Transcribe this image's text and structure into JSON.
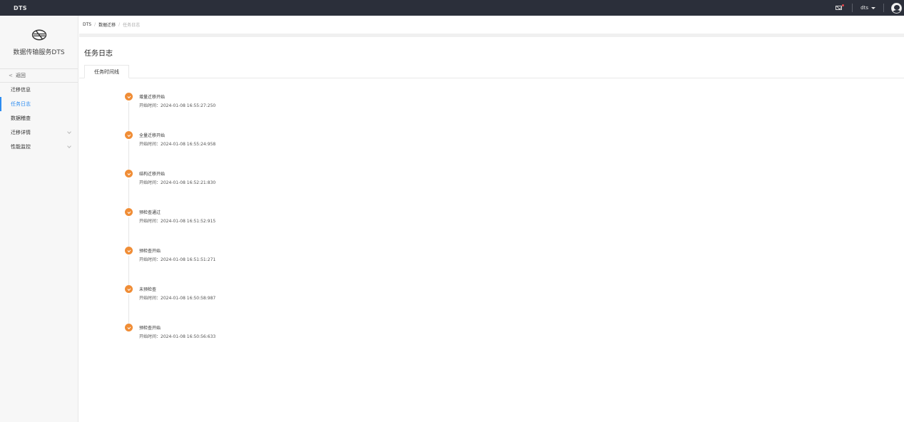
{
  "topbar": {
    "brand": "DTS",
    "user": "dts"
  },
  "sidebar": {
    "title": "数据传输服务DTS",
    "back_label": "返回",
    "items": [
      {
        "label": "迁移信息",
        "active": false,
        "expandable": false
      },
      {
        "label": "任务日志",
        "active": true,
        "expandable": false
      },
      {
        "label": "数据稽查",
        "active": false,
        "expandable": false
      },
      {
        "label": "迁移详情",
        "active": false,
        "expandable": true
      },
      {
        "label": "性能监控",
        "active": false,
        "expandable": true
      }
    ]
  },
  "breadcrumb": {
    "root": "DTS",
    "mid": "数据迁移",
    "current": "任务日志"
  },
  "page": {
    "title": "任务日志",
    "tab": "任务时间线"
  },
  "timeline": {
    "time_prefix": "开始时间：",
    "events": [
      {
        "title": "增量迁移开始",
        "time": "2024-01-08 16:55:27:250"
      },
      {
        "title": "全量迁移开始",
        "time": "2024-01-08 16:55:24:958"
      },
      {
        "title": "结构迁移开始",
        "time": "2024-01-08 16:52:21:830"
      },
      {
        "title": "预检查通过",
        "time": "2024-01-08 16:51:52:915"
      },
      {
        "title": "预检查开始",
        "time": "2024-01-08 16:51:51:271"
      },
      {
        "title": "未预检查",
        "time": "2024-01-08 16:50:58:987"
      },
      {
        "title": "预检查开始",
        "time": "2024-01-08 16:50:56:633"
      }
    ]
  },
  "colors": {
    "accent": "#2d8cf0",
    "timeline_dot": "#f08d36",
    "topbar": "#2b2f3a"
  }
}
